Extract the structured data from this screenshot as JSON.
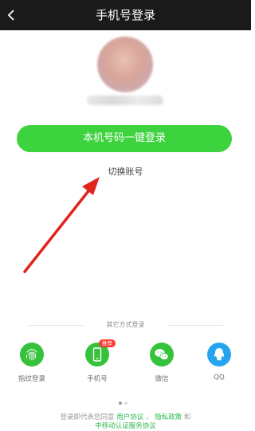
{
  "header": {
    "title": "手机号登录",
    "back_icon": "chevron-left-icon"
  },
  "profile": {
    "avatar": "avatar-image",
    "username": ""
  },
  "primary": {
    "login_label": "本机号码一键登录",
    "color": "#3cd33e"
  },
  "switch_account": {
    "label": "切换账号"
  },
  "other_methods": {
    "label": "其它方式登录",
    "options": [
      {
        "label": "指纹登录",
        "icon": "fingerprint-icon",
        "color": "#36c23a"
      },
      {
        "label": "手机号",
        "icon": "phone-icon",
        "color": "#36c23a",
        "badge": "推荐"
      },
      {
        "label": "微信",
        "icon": "wechat-icon",
        "color": "#36c23a"
      },
      {
        "label": "QQ",
        "icon": "qq-icon",
        "color": "#27a4ee"
      }
    ]
  },
  "pagination": {
    "count": 2,
    "active": 1
  },
  "terms": {
    "prefix": "登录即代表您同意",
    "user_agreement": "用户协议",
    "separator": "、",
    "privacy_policy": "隐私政策",
    "and": "和",
    "carrier_terms": "中移动认证服务协议"
  },
  "annotation": {
    "arrow_color": "#e0241c"
  }
}
